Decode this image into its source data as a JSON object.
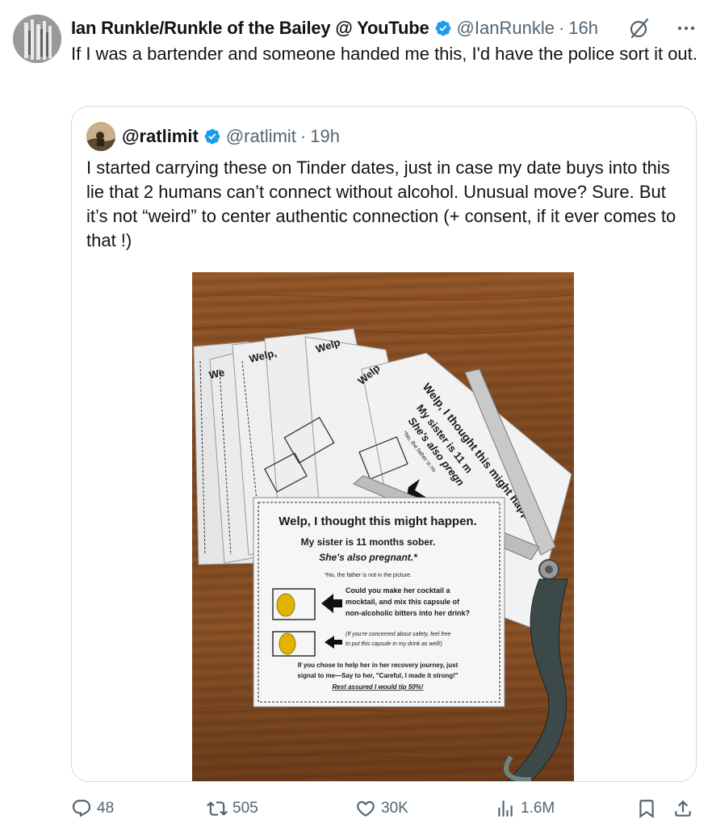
{
  "post": {
    "author_name": "Ian Runkle/Runkle of the Bailey @ YouTube",
    "handle": "@IanRunkle",
    "separator": "·",
    "time": "16h",
    "text": "If I was a bartender and someone handed me this, I'd have the police sort it out."
  },
  "quoted_post": {
    "author_name": "@ratlimit",
    "handle": "@ratlimit",
    "separator": "·",
    "time": "19h",
    "text": "I started carrying these on Tinder dates, just in case my date buys into this lie that 2 humans can’t connect without alcohol. Unusual move? Sure. But it’s not “weird” to center authentic connection (+ consent, if it ever comes to that !)"
  },
  "photo_card": {
    "title": "Welp, I thought this might happen.",
    "line1": "My sister is 11 months sober.",
    "line2": "She's also pregnant.*",
    "footnote": "*No, the father is not in the picture.",
    "ask_line1": "Could you make her cocktail a",
    "ask_line2": "mocktail, and mix this capsule of",
    "ask_line3": "non-alcoholic bitters into her drink?",
    "safety_line1": "(If you're concerned about safety, feel free",
    "safety_line2": "to put this capsule in my drink as well!)",
    "help_line1": "If you chose to help her in her recovery journey, just",
    "help_line2": "signal to me—Say to her, \"Careful, I made it strong!\"",
    "tip_line": "Rest assured I would tip 50%!",
    "back_card_title": "Welp, I thought this might happen",
    "back_card_line1": "My sister is 11 m",
    "back_card_line2": "She's also pregn",
    "back_card_footnote": "*No, the father is no",
    "back_card_word": "Welp,",
    "back_card_word2": "Welp",
    "back_card_word3": "We"
  },
  "actions": {
    "replies": "48",
    "reposts": "505",
    "likes": "30K",
    "views": "1.6M"
  },
  "icons": {
    "verified": "verified-badge-icon",
    "grok": "grok-icon",
    "more": "more-icon",
    "reply": "reply-icon",
    "repost": "repost-icon",
    "like": "heart-icon",
    "views": "views-icon",
    "bookmark": "bookmark-icon",
    "share": "share-icon"
  },
  "colors": {
    "verified_blue": "#1d9bf0",
    "secondary_text": "#536471",
    "border": "#cfd9de"
  }
}
